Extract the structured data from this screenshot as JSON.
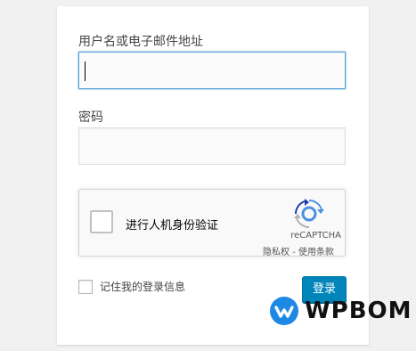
{
  "login_form": {
    "username_label": "用户名或电子邮件地址",
    "username_value": "",
    "password_label": "密码",
    "password_value": "",
    "remember_label": "记住我的登录信息",
    "submit_label": "登录"
  },
  "recaptcha": {
    "checkbox_label": "进行人机身份验证",
    "brand": "reCAPTCHA",
    "privacy_label": "隐私权",
    "separator": " - ",
    "terms_label": "使用条款"
  },
  "watermark": {
    "text": "WPBOM",
    "icon": "wpbom-logo"
  },
  "colors": {
    "primary_button": "#0085ba",
    "focus_border": "#5b9dd9",
    "recaptcha_blue": "#4a90e2",
    "recaptcha_grey": "#b1b1b1",
    "watermark_blue": "#1e88e5"
  }
}
